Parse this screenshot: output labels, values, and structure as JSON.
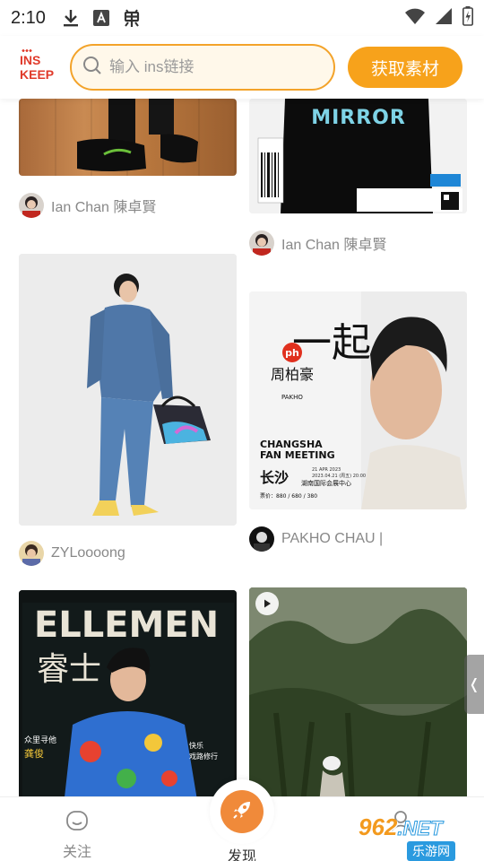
{
  "status_bar": {
    "time": "2:10",
    "icons": [
      "download-icon",
      "font-icon",
      "bug-icon"
    ],
    "right_icons": [
      "wifi-icon",
      "signal-icon",
      "battery-charging-icon"
    ]
  },
  "header": {
    "logo_line1": "INS",
    "logo_line2": "KEEP",
    "search_placeholder": "输入 ins链接",
    "fetch_button": "获取素材"
  },
  "feed": {
    "cards": [
      {
        "author": "Ian Chan 陳卓賢",
        "image": "sneakers on wood floor"
      },
      {
        "author": "Ian Chan 陳卓賢",
        "image": "black sweatshirt with MIRROR print"
      },
      {
        "author": "ZYLoooong",
        "image": "man in denim suit with bag"
      },
      {
        "author": "PAKHO CHAU |",
        "image": "Changsha fan meeting poster"
      },
      {
        "author": "",
        "image": "magazine cover"
      },
      {
        "author": "",
        "image": "outdoor video",
        "is_video": true
      }
    ],
    "poster": {
      "logo": "ph",
      "name_cn": "周柏豪",
      "name_vertical": "PAKHO",
      "big_chars": "一起",
      "title_line1": "CHANGSHA",
      "title_line2": "FAN MEETING",
      "date": "21 APR 2023",
      "date_cn": "2023.04.21 (周五) 20:00",
      "city": "长沙",
      "venue": "湖南国际会展中心",
      "price": "票价：880 / 680 / 380"
    },
    "magazine": {
      "title": "ELLEMEN",
      "cn_title": "睿士",
      "cover_name": "龚俊",
      "cover_line1": "众里寻他",
      "cover_line2": "快乐",
      "cover_line3": "戏路修行"
    },
    "sweatshirt_print": "MIRROR"
  },
  "bottom_nav": {
    "follow": "关注",
    "discover": "发现",
    "mine": ""
  },
  "watermark": {
    "top": "962",
    "net": ".NET",
    "bottom": "乐游网"
  },
  "colors": {
    "accent": "#f7a21b",
    "search_border": "#f3a32a",
    "logo_red": "#e03a2a",
    "discover": "#f08a3a"
  }
}
